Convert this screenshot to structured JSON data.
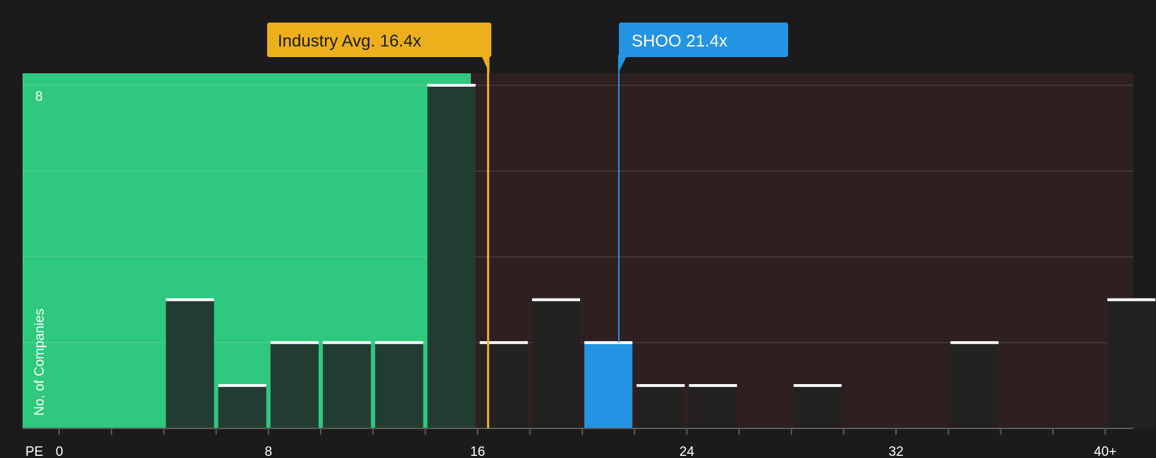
{
  "chart_data": {
    "type": "bar",
    "xlabel": "PE",
    "ylabel": "No. of Companies",
    "x_ticks": [
      "0",
      "8",
      "16",
      "24",
      "32",
      "40+"
    ],
    "y_tick": "8",
    "ylim": [
      0,
      8
    ],
    "grid": true,
    "bin_width": 2,
    "bins": [
      {
        "x_start": 0,
        "count": 0
      },
      {
        "x_start": 2,
        "count": 0
      },
      {
        "x_start": 4,
        "count": 3
      },
      {
        "x_start": 6,
        "count": 1
      },
      {
        "x_start": 8,
        "count": 2
      },
      {
        "x_start": 10,
        "count": 2
      },
      {
        "x_start": 12,
        "count": 2
      },
      {
        "x_start": 14,
        "count": 8
      },
      {
        "x_start": 16,
        "count": 2
      },
      {
        "x_start": 18,
        "count": 3
      },
      {
        "x_start": 20,
        "count": 2,
        "highlight": true
      },
      {
        "x_start": 22,
        "count": 1
      },
      {
        "x_start": 24,
        "count": 1
      },
      {
        "x_start": 26,
        "count": 0
      },
      {
        "x_start": 28,
        "count": 1
      },
      {
        "x_start": 30,
        "count": 0
      },
      {
        "x_start": 32,
        "count": 0
      },
      {
        "x_start": 34,
        "count": 2
      },
      {
        "x_start": 36,
        "count": 0
      },
      {
        "x_start": 38,
        "count": 0
      },
      {
        "x_start": 40,
        "count": 3
      }
    ],
    "industry_avg": {
      "value": 16.4,
      "label": "Industry Avg. 16.4x"
    },
    "company": {
      "value": 21.4,
      "label": "SHOO 21.4x"
    },
    "good_zone_max": 16.4,
    "colors": {
      "background": "#1b1b1b",
      "good_zone": "#2ec87e",
      "bad_zone": "#2e1f20",
      "bar_dark": "#213d32",
      "bar_neutral": "#242121",
      "bar_highlight": "#2394e3",
      "industry": "#ecb01c",
      "company": "#2394e3",
      "cap": "#ffffff"
    }
  }
}
